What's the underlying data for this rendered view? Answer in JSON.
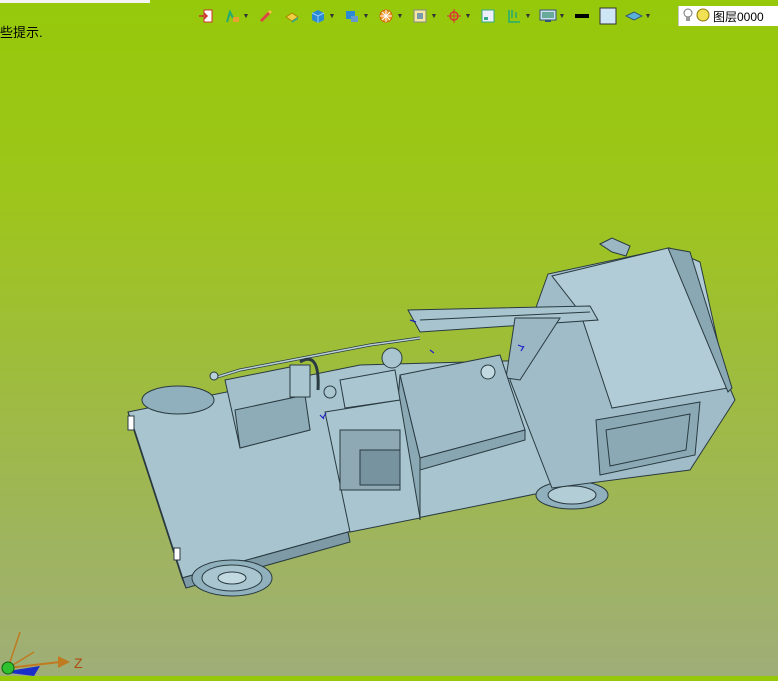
{
  "status": {
    "hint_text": "些提示."
  },
  "layer": {
    "name": "图层0000"
  },
  "axis": {
    "z_label": "Z"
  },
  "colors": {
    "model_body": "#9fbcc8",
    "model_edge": "#2a3a40",
    "background_top": "#96c90a",
    "background_bottom": "#9fae78"
  },
  "toolbar": {
    "icons": [
      "import-icon",
      "sketch-icon",
      "pencil-icon",
      "solid-icon",
      "box-icon",
      "assembly-icon",
      "wheel-icon",
      "view-icon",
      "snap-icon",
      "frame-icon",
      "dimension-icon",
      "display-icon",
      "color-black-icon",
      "color-lightblue-icon",
      "layer-icon"
    ]
  }
}
